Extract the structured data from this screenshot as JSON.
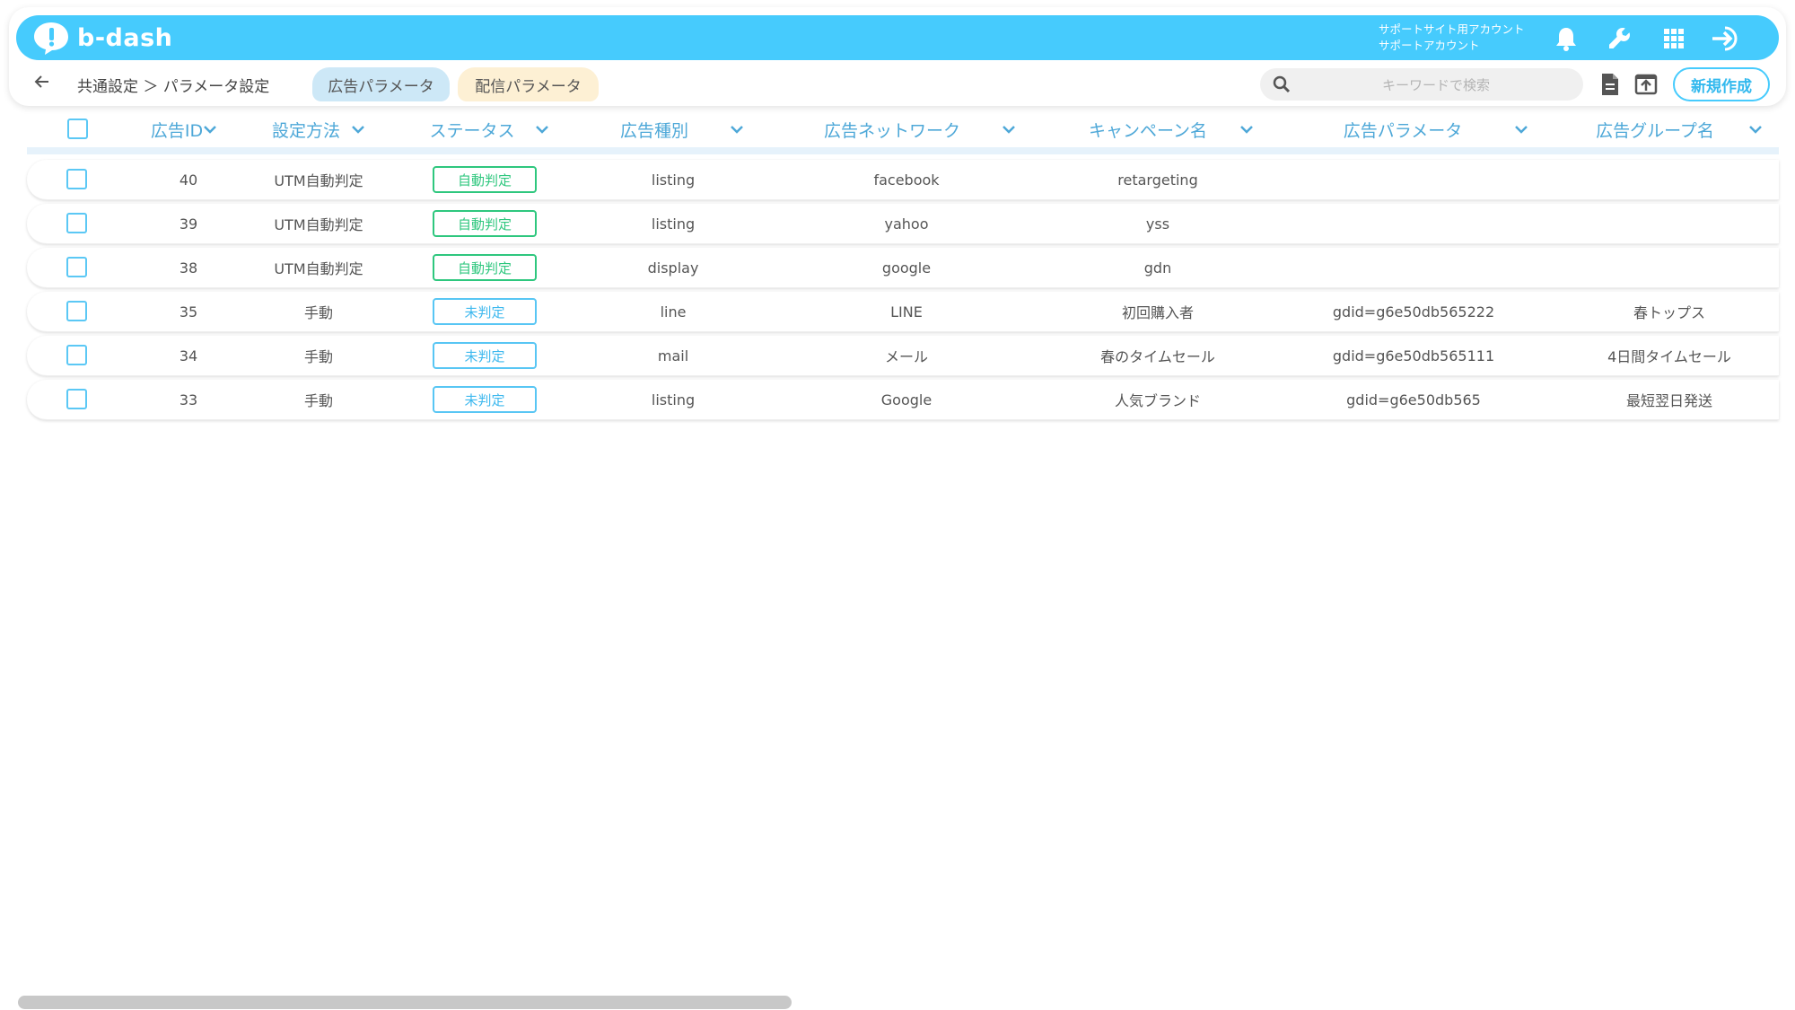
{
  "header": {
    "logo_text": "b-dash",
    "account_line1": "サポートサイト用アカウント",
    "account_line2": "サポートアカウント",
    "icons": [
      "bell-icon",
      "wrench-icon",
      "grid-icon",
      "logout-icon"
    ],
    "bar_color": "#46cbfd"
  },
  "nav": {
    "breadcrumb": "共通設定 ＞ パラメータ設定",
    "tabs": [
      {
        "label": "広告パラメータ",
        "active": true
      },
      {
        "label": "配信パラメータ",
        "active": false
      }
    ],
    "search_placeholder": "キーワードで検索",
    "new_button": "新規作成"
  },
  "table": {
    "columns": [
      "広告ID",
      "設定方法",
      "ステータス",
      "広告種別",
      "広告ネットワーク",
      "キャンペーン名",
      "広告パラメータ",
      "広告グループ名"
    ],
    "rows": [
      {
        "id": "40",
        "method": "UTM自動判定",
        "status": "自動判定",
        "status_type": "green",
        "type": "listing",
        "network": "facebook",
        "campaign": "retargeting",
        "param": "",
        "group": ""
      },
      {
        "id": "39",
        "method": "UTM自動判定",
        "status": "自動判定",
        "status_type": "green",
        "type": "listing",
        "network": "yahoo",
        "campaign": "yss",
        "param": "",
        "group": ""
      },
      {
        "id": "38",
        "method": "UTM自動判定",
        "status": "自動判定",
        "status_type": "green",
        "type": "display",
        "network": "google",
        "campaign": "gdn",
        "param": "",
        "group": ""
      },
      {
        "id": "35",
        "method": "手動",
        "status": "未判定",
        "status_type": "blue",
        "type": "line",
        "network": "LINE",
        "campaign": "初回購入者",
        "param": "gdid=g6e50db565222",
        "group": "春トップス"
      },
      {
        "id": "34",
        "method": "手動",
        "status": "未判定",
        "status_type": "blue",
        "type": "mail",
        "network": "メール",
        "campaign": "春のタイムセール",
        "param": "gdid=g6e50db565111",
        "group": "4日間タイムセール"
      },
      {
        "id": "33",
        "method": "手動",
        "status": "未判定",
        "status_type": "blue",
        "type": "listing",
        "network": "Google",
        "campaign": "人気ブランド",
        "param": "gdid=g6e50db565",
        "group": "最短翌日発送"
      }
    ]
  },
  "colors": {
    "green": "#2ec77e",
    "blue": "#58c6f4",
    "accent": "#46cbfd"
  }
}
